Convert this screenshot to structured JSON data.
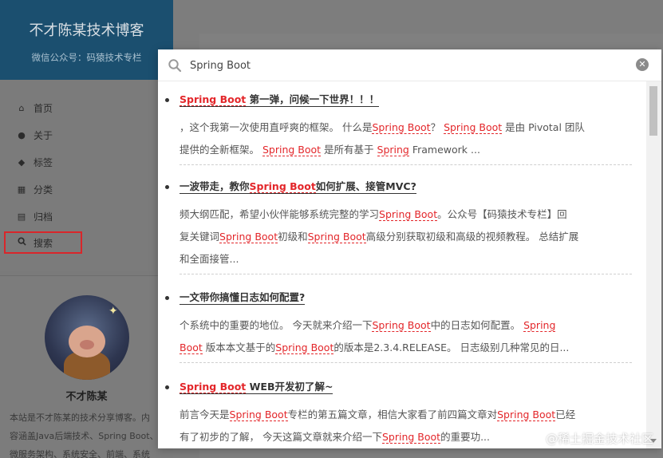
{
  "site": {
    "title": "不才陈某技术博客",
    "subtitle": "微信公众号：码猿技术专栏"
  },
  "nav": {
    "items": [
      {
        "label": "首页",
        "icon": "home-icon"
      },
      {
        "label": "关于",
        "icon": "user-icon"
      },
      {
        "label": "标签",
        "icon": "tags-icon"
      },
      {
        "label": "分类",
        "icon": "grid-icon"
      },
      {
        "label": "归档",
        "icon": "archive-icon"
      },
      {
        "label": "搜索",
        "icon": "search-icon"
      }
    ]
  },
  "profile": {
    "name": "不才陈某",
    "desc_lines": [
      "本站是不才陈某的技术分享博客。内",
      "容涵盖Java后端技术、Spring Boot、",
      "微服务架构、系统安全、前端、系统"
    ]
  },
  "search": {
    "query": "Spring Boot",
    "clear_label": "✕"
  },
  "results": [
    {
      "title_parts": [
        {
          "t": "Spring Boot",
          "hl": true
        },
        {
          "t": " 第一弹，问候一下世界！！！",
          "hl": false
        }
      ],
      "lines": [
        [
          {
            "t": "，这个我第一次使用直呼爽的框架。 什么是",
            "hl": false
          },
          {
            "t": "Spring Boot",
            "hl": true
          },
          {
            "t": "？ ",
            "hl": false
          },
          {
            "t": "Spring Boot",
            "hl": true
          },
          {
            "t": " 是由 Pivotal 团队",
            "hl": false
          }
        ],
        [
          {
            "t": "提供的全新框架。 ",
            "hl": false
          },
          {
            "t": "Spring Boot",
            "hl": true
          },
          {
            "t": " 是所有基于 ",
            "hl": false
          },
          {
            "t": "Spring",
            "hl": true
          },
          {
            "t": " Framework ...",
            "hl": false
          }
        ]
      ]
    },
    {
      "title_parts": [
        {
          "t": "一波带走，教你",
          "hl": false
        },
        {
          "t": "Spring Boot",
          "hl": true
        },
        {
          "t": "如何扩展、接管MVC?",
          "hl": false
        }
      ],
      "lines": [
        [
          {
            "t": "频大纲匹配，希望小伙伴能够系统完整的学习",
            "hl": false
          },
          {
            "t": "Spring Boot",
            "hl": true
          },
          {
            "t": "。公众号【码猿技术专栏】回",
            "hl": false
          }
        ],
        [
          {
            "t": "复关键词",
            "hl": false
          },
          {
            "t": "Spring Boot",
            "hl": true
          },
          {
            "t": "初级和",
            "hl": false
          },
          {
            "t": "Spring Boot",
            "hl": true
          },
          {
            "t": "高级分别获取初级和高级的视频教程。 总结扩展",
            "hl": false
          }
        ],
        [
          {
            "t": "和全面接管...",
            "hl": false
          }
        ]
      ]
    },
    {
      "title_parts": [
        {
          "t": "一文带你搞懂日志如何配置?",
          "hl": false
        }
      ],
      "lines": [
        [
          {
            "t": "个系统中的重要的地位。 今天就来介绍一下",
            "hl": false
          },
          {
            "t": "Spring Boot",
            "hl": true
          },
          {
            "t": "中的日志如何配置。 ",
            "hl": false
          },
          {
            "t": "Spring",
            "hl": true
          }
        ],
        [
          {
            "t": "Boot",
            "hl": true
          },
          {
            "t": " 版本本文基于的",
            "hl": false
          },
          {
            "t": "Spring Boot",
            "hl": true
          },
          {
            "t": "的版本是2.3.4.RELEASE。 日志级别几种常见的日...",
            "hl": false
          }
        ]
      ]
    },
    {
      "title_parts": [
        {
          "t": "Spring Boot",
          "hl": true
        },
        {
          "t": " WEB开发初了解~",
          "hl": false
        }
      ],
      "lines": [
        [
          {
            "t": "前言今天是",
            "hl": false
          },
          {
            "t": "Spring Boot",
            "hl": true
          },
          {
            "t": "专栏的第五篇文章，相信大家看了前四篇文章对",
            "hl": false
          },
          {
            "t": "Spring Boot",
            "hl": true
          },
          {
            "t": "已经",
            "hl": false
          }
        ],
        [
          {
            "t": "有了初步的了解， 今天这篇文章就来介绍一下",
            "hl": false
          },
          {
            "t": "Spring Boot",
            "hl": true
          },
          {
            "t": "的重要功...",
            "hl": false
          }
        ]
      ]
    }
  ],
  "watermark": "@稀土掘金技术社区"
}
